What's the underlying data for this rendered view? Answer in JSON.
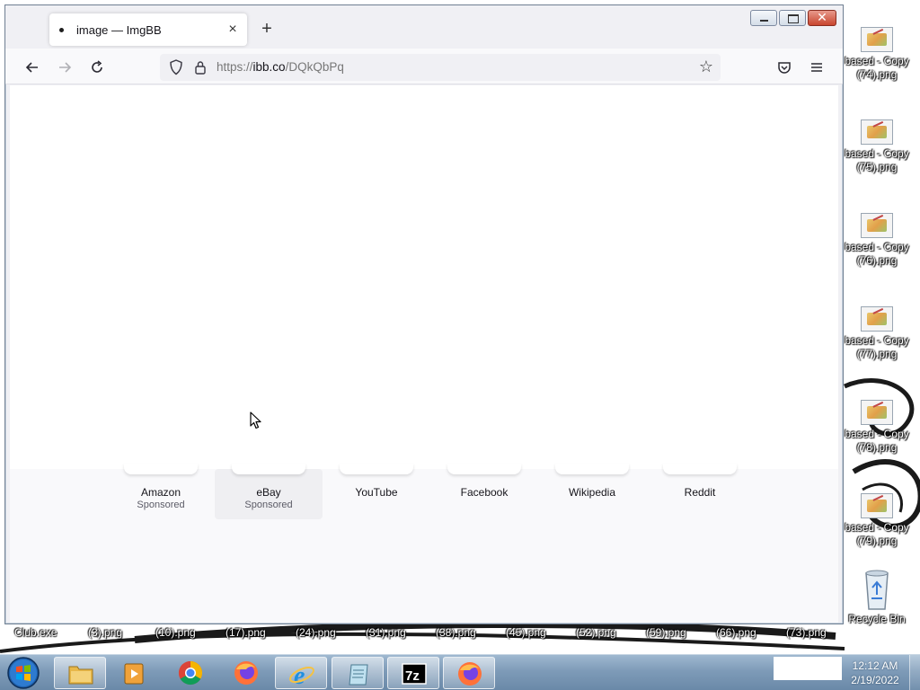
{
  "browser": {
    "tab_title": "image — ImgBB",
    "tab_close": "×",
    "new_tab": "+",
    "url_prefix": "https://",
    "url_host": "ibb.co",
    "url_path": "/DQkQbPq",
    "close_glyph": "✕"
  },
  "shortcuts": [
    {
      "title": "Amazon",
      "sub": "Sponsored"
    },
    {
      "title": "eBay",
      "sub": "Sponsored"
    },
    {
      "title": "YouTube",
      "sub": ""
    },
    {
      "title": "Facebook",
      "sub": ""
    },
    {
      "title": "Wikipedia",
      "sub": ""
    },
    {
      "title": "Reddit",
      "sub": ""
    }
  ],
  "desktop": {
    "right_icons": [
      {
        "line1": "based - Copy",
        "line2": "(74).png"
      },
      {
        "line1": "based - Copy",
        "line2": "(75).png"
      },
      {
        "line1": "based - Copy",
        "line2": "(76).png"
      },
      {
        "line1": "based - Copy",
        "line2": "(77).png"
      },
      {
        "line1": "based - Copy",
        "line2": "(78).png"
      },
      {
        "line1": "based - Copy",
        "line2": "(79).png"
      }
    ],
    "recycle_bin": "Recycle Bin",
    "bottom_row": [
      "Club.exe",
      "(3).png",
      "(10).png",
      "(17).png",
      "(24).png",
      "(31).png",
      "(38).png",
      "(45).png",
      "(52).png",
      "(59).png",
      "(66).png",
      "(73).png"
    ]
  },
  "taskbar": {
    "time": "12:12 AM",
    "date": "2/19/2022",
    "apps": [
      "file-explorer",
      "media-player",
      "chrome",
      "firefox",
      "internet-explorer",
      "notepad",
      "7zip",
      "firefox-active"
    ]
  }
}
